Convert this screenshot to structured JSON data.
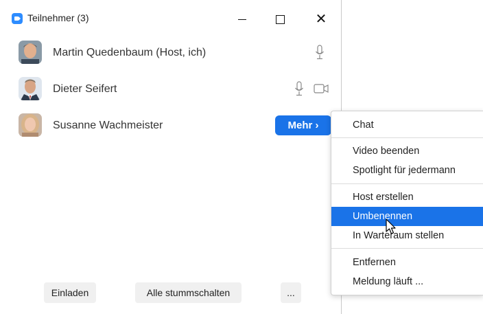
{
  "window": {
    "title": "Teilnehmer (3)",
    "controls": {
      "minimize": "—",
      "maximize": "",
      "close": "✕"
    }
  },
  "participants": [
    {
      "name": "Martin Quedenbaum (Host, ich)",
      "mic": "mic-icon",
      "video": null
    },
    {
      "name": "Dieter Seifert",
      "mic": "mic-icon",
      "video": "camera-icon"
    },
    {
      "name": "Susanne Wachmeister",
      "mic": null,
      "video": null
    }
  ],
  "more_button": {
    "label": "Mehr ›"
  },
  "footer": {
    "invite_label": "Einladen",
    "mute_all_label": "Alle stummschalten",
    "more_label": "..."
  },
  "context_menu": {
    "items": [
      "Chat",
      "Video beenden",
      "Spotlight für jedermann",
      "Host erstellen",
      "Umbenennen",
      "In Warteraum stellen",
      "Entfernen",
      "Meldung läuft ..."
    ],
    "highlighted_item": "Umbenennen"
  },
  "colors": {
    "accent": "#1a73e8",
    "app_icon": "#2d8cff"
  }
}
